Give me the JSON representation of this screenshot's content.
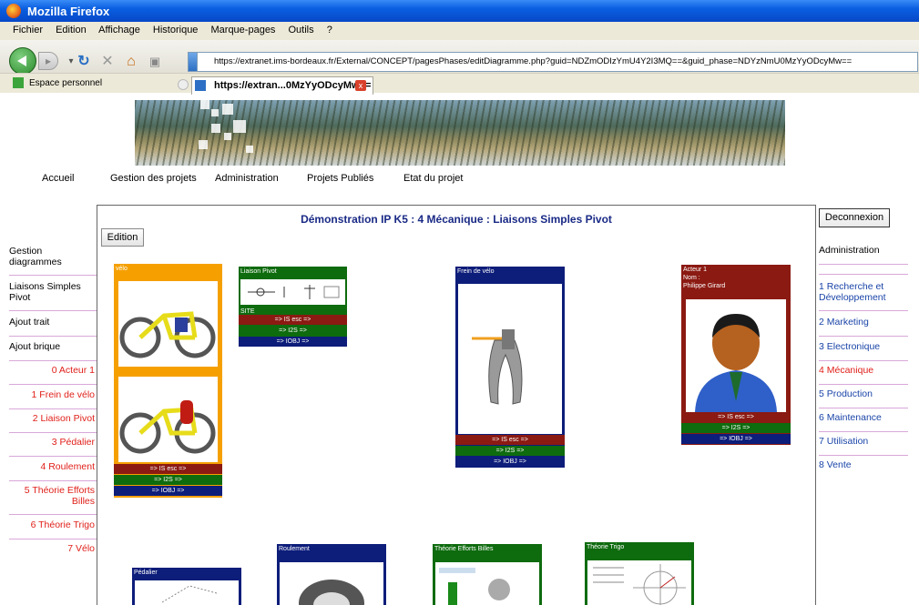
{
  "window": {
    "title": "Mozilla Firefox"
  },
  "menu": [
    "Fichier",
    "Edition",
    "Affichage",
    "Historique",
    "Marque-pages",
    "Outils",
    "?"
  ],
  "url": "https://extranet.ims-bordeaux.fr/External/CONCEPT/pagesPhases/editDiagramme.php?guid=NDZmODIzYmU4Y2I3MQ==&guid_phase=NDYzNmU0MzYyODcyMw==",
  "bookmarks": {
    "item": "Espace personnel"
  },
  "tab": {
    "label": "https://extran...0MzYyODcyMw==",
    "close": "x"
  },
  "sitenav": [
    "Accueil",
    "Gestion des projets",
    "Administration",
    "Projets Publiés",
    "Etat du projet"
  ],
  "page": {
    "title": "Démonstration IP K5 : 4 Mécanique : Liaisons Simples Pivot",
    "edit_label": "Edition"
  },
  "left_sidebar": {
    "links": [
      "Gestion diagrammes",
      "Liaisons Simples Pivot",
      "Ajout trait",
      "Ajout brique"
    ],
    "bricks": [
      "0 Acteur 1",
      "1 Frein de vélo",
      "2 Liaison Pivot",
      "3 Pédalier",
      "4 Roulement",
      "5 Théorie Efforts Billes",
      "6 Théorie Trigo",
      "7 Vélo"
    ]
  },
  "right_sidebar": {
    "deconnexion": "Deconnexion",
    "admin": "Administration",
    "phases": [
      "1 Recherche et Développement",
      "2 Marketing",
      "3 Electronique",
      "4 Mécanique",
      "5 Production",
      "6 Maintenance",
      "7 Utilisation",
      "8 Vente"
    ],
    "active_color": "#e0201a",
    "link_color": "#1a44a8"
  },
  "bars": {
    "is": "=> IS esc =>",
    "i2s": "=> I2S =>",
    "iobj": "=> IOBJ =>"
  },
  "cards": {
    "velo": {
      "title": "vélo"
    },
    "pivot": {
      "title": "Liaison Pivot",
      "site": "SITE"
    },
    "frein": {
      "title": "Frein de vélo"
    },
    "acteur": {
      "title": "Acteur 1",
      "nom": "Nom :",
      "name": "Philippe Girard"
    },
    "pedalier": {
      "title": "Pédalier"
    },
    "roulement": {
      "title": "Roulement"
    },
    "efforts": {
      "title": "Théorie Efforts Billes"
    },
    "trigo": {
      "title": "Théorie Trigo"
    }
  },
  "colors": {
    "orange": "#f5a000",
    "green": "#0e6b0e",
    "navy": "#0d1d7a",
    "darkred": "#8b1a12"
  }
}
